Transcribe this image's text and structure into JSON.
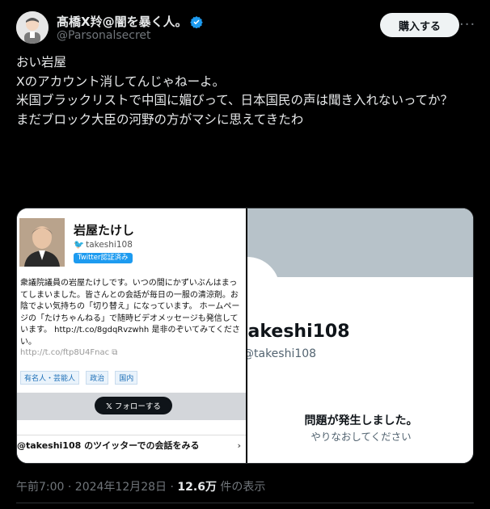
{
  "author": {
    "name": "髙橋X羚@闇を暴く人。",
    "handle": "@Parsonalsecret",
    "buy_label": "購入する",
    "more_label": "···"
  },
  "tweet": {
    "lines": [
      "おい岩屋",
      "",
      "Xのアカウント消してんじゃねーよ。",
      "",
      "米国ブラックリストで中国に媚びって、日本国民の声は聞き入れないってか？",
      "まだブロック大臣の河野の方がマシに思えてきたわ"
    ]
  },
  "media_left": {
    "name": "岩屋たけし",
    "handle": "takeshi108",
    "badge": "Twitter認証済み",
    "bio": "衆議院議員の岩屋たけしです。いつの間にかずいぶんはまってしまいました。皆さんとの会話が毎日の一服の清涼剤。お陰でよい気持ちの「切り替え」になっています。 ホームページの「たけちゃんねる」で随時ビデオメッセージも発信しています。 http://t.co/8gdqRvzwhh 是非のぞいてみてください。",
    "link": "http://t.co/ftp8U4Fnac",
    "tags": [
      "有名人・芸能人",
      "政治",
      "国内"
    ],
    "follow_label": "フォローする",
    "convo": "@takeshi108 のツイッターでの会話をみる"
  },
  "media_right": {
    "name": "takeshi108",
    "handle": "@takeshi108",
    "error": "問題が発生しました。",
    "retry": "やりなおしてください"
  },
  "meta": {
    "time": "午前7:00 · 2024年12月28日 · ",
    "views": "12.6万",
    "views_suffix": " 件の表示"
  },
  "colors": {
    "background": "#000000",
    "verified": "#1d9bf0",
    "muted": "#71767b"
  }
}
